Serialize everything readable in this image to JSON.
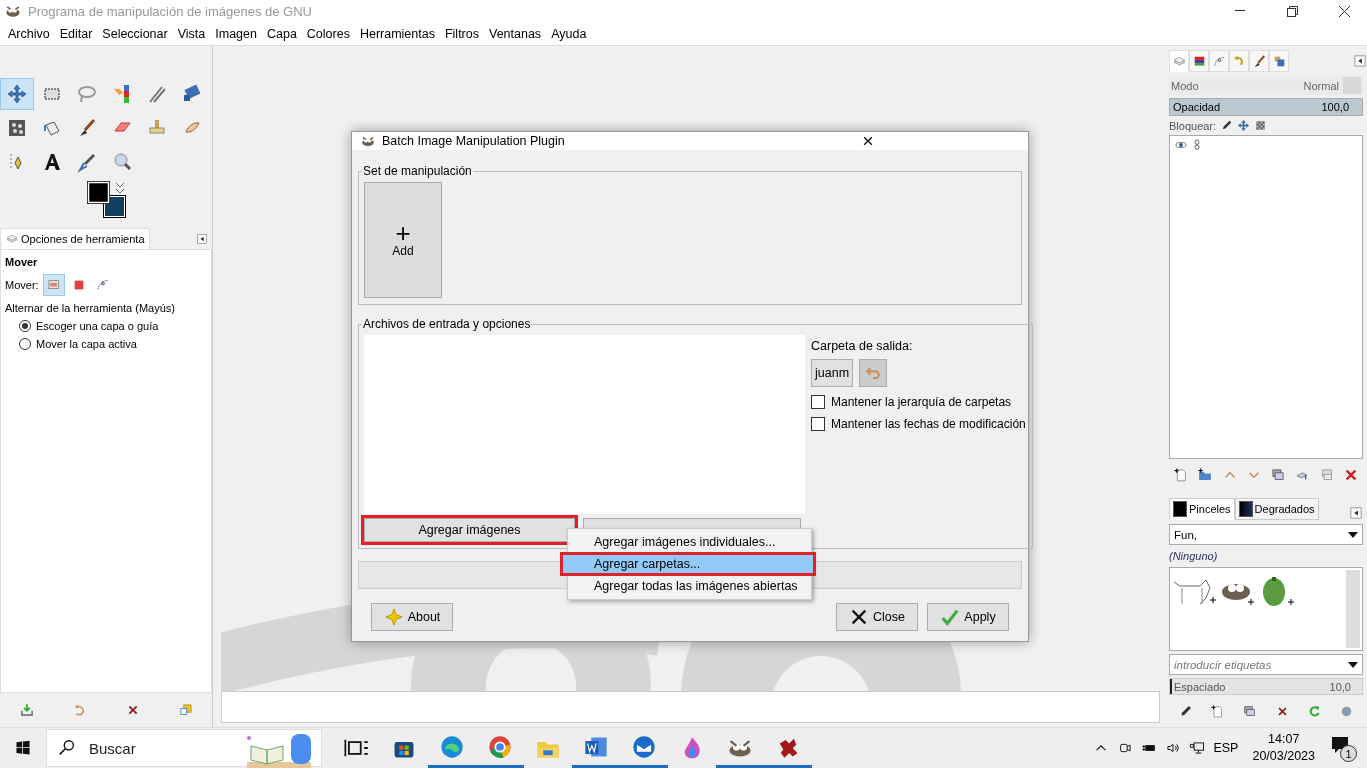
{
  "window": {
    "title": "Programa de manipulación de imágenes de GNU"
  },
  "menu": [
    "Archivo",
    "Editar",
    "Seleccionar",
    "Vista",
    "Imagen",
    "Capa",
    "Colores",
    "Herramientas",
    "Filtros",
    "Ventanas",
    "Ayuda"
  ],
  "toolbox": {
    "tools": [
      {
        "kind": "move",
        "selected": true
      },
      {
        "kind": "rect",
        "selected": false
      },
      {
        "kind": "lasso",
        "selected": false
      },
      {
        "kind": "fgselect",
        "selected": false
      },
      {
        "kind": "crop",
        "selected": false
      },
      {
        "kind": "transform",
        "selected": false
      },
      {
        "kind": "warp",
        "selected": false
      },
      {
        "kind": "bucket",
        "selected": false
      },
      {
        "kind": "brush",
        "selected": false
      },
      {
        "kind": "eraser",
        "selected": false
      },
      {
        "kind": "stamp",
        "selected": false
      },
      {
        "kind": "smudge",
        "selected": false
      },
      {
        "kind": "path",
        "selected": false
      },
      {
        "kind": "text",
        "selected": false
      },
      {
        "kind": "picker",
        "selected": false
      },
      {
        "kind": "zoom",
        "selected": false
      }
    ]
  },
  "tool_options": {
    "tab": "Opciones de herramienta",
    "title": "Mover",
    "move_label": "Mover:",
    "modes": [
      {
        "kind": "layer",
        "selected": true
      },
      {
        "kind": "selection",
        "selected": false
      },
      {
        "kind": "path",
        "selected": false
      }
    ],
    "toggle_label": "Alternar de la herramienta  (Mayús)",
    "options": [
      {
        "label": "Escoger una capa o guía",
        "selected": true
      },
      {
        "label": "Mover la capa activa",
        "selected": false
      }
    ]
  },
  "layers_dock": {
    "tabs": [
      {
        "kind": "layers",
        "selected": true
      },
      {
        "kind": "channels",
        "selected": false
      },
      {
        "kind": "paths",
        "selected": false
      },
      {
        "kind": "undo",
        "selected": false
      },
      {
        "kind": "brush",
        "selected": false
      },
      {
        "kind": "images",
        "selected": false
      }
    ],
    "mode_label": "Modo",
    "mode_value": "Normal",
    "opacity_label": "Opacidad",
    "opacity_value": "100,0",
    "opacity": {
      "level": 1.0
    },
    "lock_label": "Bloquear:"
  },
  "brushes_dock": {
    "tabs": [
      {
        "label": "Pinceles",
        "selected": true
      },
      {
        "label": "Degradados",
        "selected": false
      }
    ],
    "tag_filter": "Fun,",
    "brush_name": "(Ninguno)",
    "tag_placeholder": "introducir etiquetas",
    "spacing_label": "Espaciado",
    "spacing_value": "10,0",
    "spacing": {
      "level": 0.01
    }
  },
  "dialog": {
    "title": "Batch Image Manipulation Plugin",
    "set_label": "Set de manipulación",
    "add_symbol": "+",
    "add_label": "Add",
    "input_label": "Archivos de entrada y opciones",
    "add_images": {
      "label": "Agregar imágenes",
      "annotated": true
    },
    "output_label": "Carpeta de salida:",
    "output_folder": "juanm",
    "checks": [
      {
        "label": "Mantener la jerarquía de carpetas",
        "checked": false
      },
      {
        "label": "Mantener las fechas de modificación",
        "checked": false
      }
    ],
    "progress": {
      "level": 0
    },
    "buttons": [
      {
        "kind": "about",
        "label": "About"
      },
      {
        "kind": "close",
        "label": "Close"
      },
      {
        "kind": "apply",
        "label": "Apply"
      }
    ]
  },
  "popup_menu": [
    {
      "label": "Agregar imágenes individuales...",
      "selected": false,
      "annotated": false
    },
    {
      "label": "Agregar carpetas...",
      "selected": true,
      "annotated": true
    },
    {
      "label": "Agregar todas las imágenes abiertas",
      "selected": false,
      "annotated": false
    }
  ],
  "taskbar": {
    "search_placeholder": "Buscar",
    "apps": [
      {
        "kind": "taskview",
        "running": false
      },
      {
        "kind": "store",
        "running": false
      },
      {
        "kind": "edge",
        "running": true
      },
      {
        "kind": "chrome",
        "running": true
      },
      {
        "kind": "files",
        "running": false
      },
      {
        "kind": "word",
        "running": true
      },
      {
        "kind": "mail",
        "running": true
      },
      {
        "kind": "flame",
        "running": false
      },
      {
        "kind": "gimp",
        "running": true
      },
      {
        "kind": "bug",
        "running": true
      }
    ],
    "language": "ESP",
    "time": "14:07",
    "date": "20/03/2023",
    "notifications": "1"
  }
}
